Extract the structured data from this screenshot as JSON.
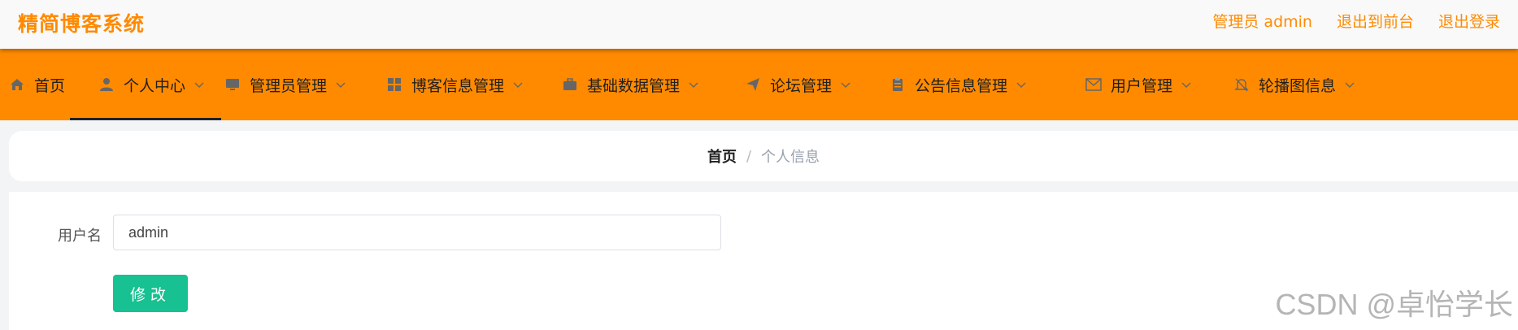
{
  "app": {
    "title": "精简博客系统"
  },
  "header": {
    "user_label": "管理员 admin",
    "front_link": "退出到前台",
    "logout_link": "退出登录"
  },
  "nav": {
    "items": [
      {
        "label": "首页",
        "icon": "home-icon"
      },
      {
        "label": "个人中心",
        "icon": "user-icon",
        "active": true
      },
      {
        "label": "管理员管理",
        "icon": "monitor-icon"
      },
      {
        "label": "博客信息管理",
        "icon": "grid-icon"
      },
      {
        "label": "基础数据管理",
        "icon": "suitcase-icon"
      },
      {
        "label": "论坛管理",
        "icon": "send-icon"
      },
      {
        "label": "公告信息管理",
        "icon": "clipboard-icon"
      },
      {
        "label": "用户管理",
        "icon": "mail-icon"
      },
      {
        "label": "轮播图信息",
        "icon": "bell-off-icon"
      }
    ]
  },
  "breadcrumb": {
    "home": "首页",
    "separator": "/",
    "current": "个人信息"
  },
  "form": {
    "username_label": "用户名",
    "username_value": "admin",
    "submit_label": "修改"
  },
  "watermark": "CSDN @卓怡学长",
  "colors": {
    "brand": "#ff8a00",
    "button": "#17c191",
    "nav_text": "#1f1f1f"
  }
}
